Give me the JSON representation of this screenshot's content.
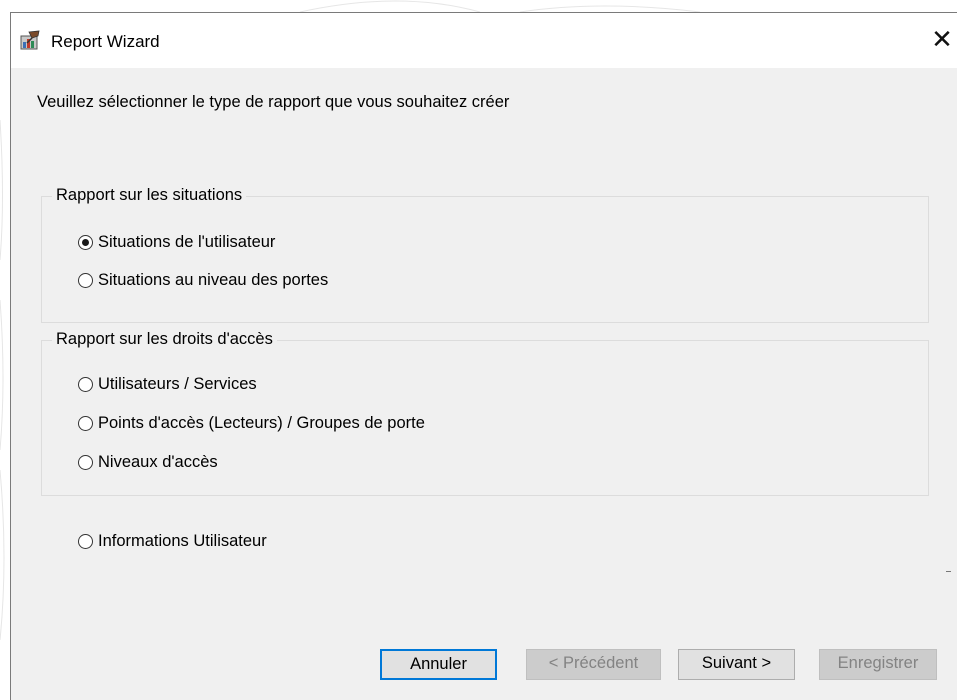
{
  "window": {
    "title": "Report Wizard",
    "close_glyph": "✕"
  },
  "instruction": "Veuillez sélectionner le type de rapport que vous souhaitez créer",
  "groups": [
    {
      "legend": "Rapport sur les situations",
      "options": [
        {
          "label": "Situations de l'utilisateur",
          "checked": true
        },
        {
          "label": "Situations au niveau des portes",
          "checked": false
        }
      ]
    },
    {
      "legend": "Rapport sur les droits d'accès",
      "options": [
        {
          "label": "Utilisateurs / Services",
          "checked": false
        },
        {
          "label": "Points d'accès (Lecteurs) / Groupes de porte",
          "checked": false
        },
        {
          "label": "Niveaux d'accès",
          "checked": false
        }
      ]
    }
  ],
  "standalone_option": {
    "label": "Informations Utilisateur",
    "checked": false
  },
  "buttons": {
    "cancel": "Annuler",
    "previous": "< Précédent",
    "next": "Suivant >",
    "save": "Enregistrer"
  },
  "colors": {
    "dialog_bg": "#f0f0f0",
    "focus_border": "#0078d7"
  },
  "icons": {
    "app": "report-wizard-icon",
    "close": "close-icon"
  }
}
